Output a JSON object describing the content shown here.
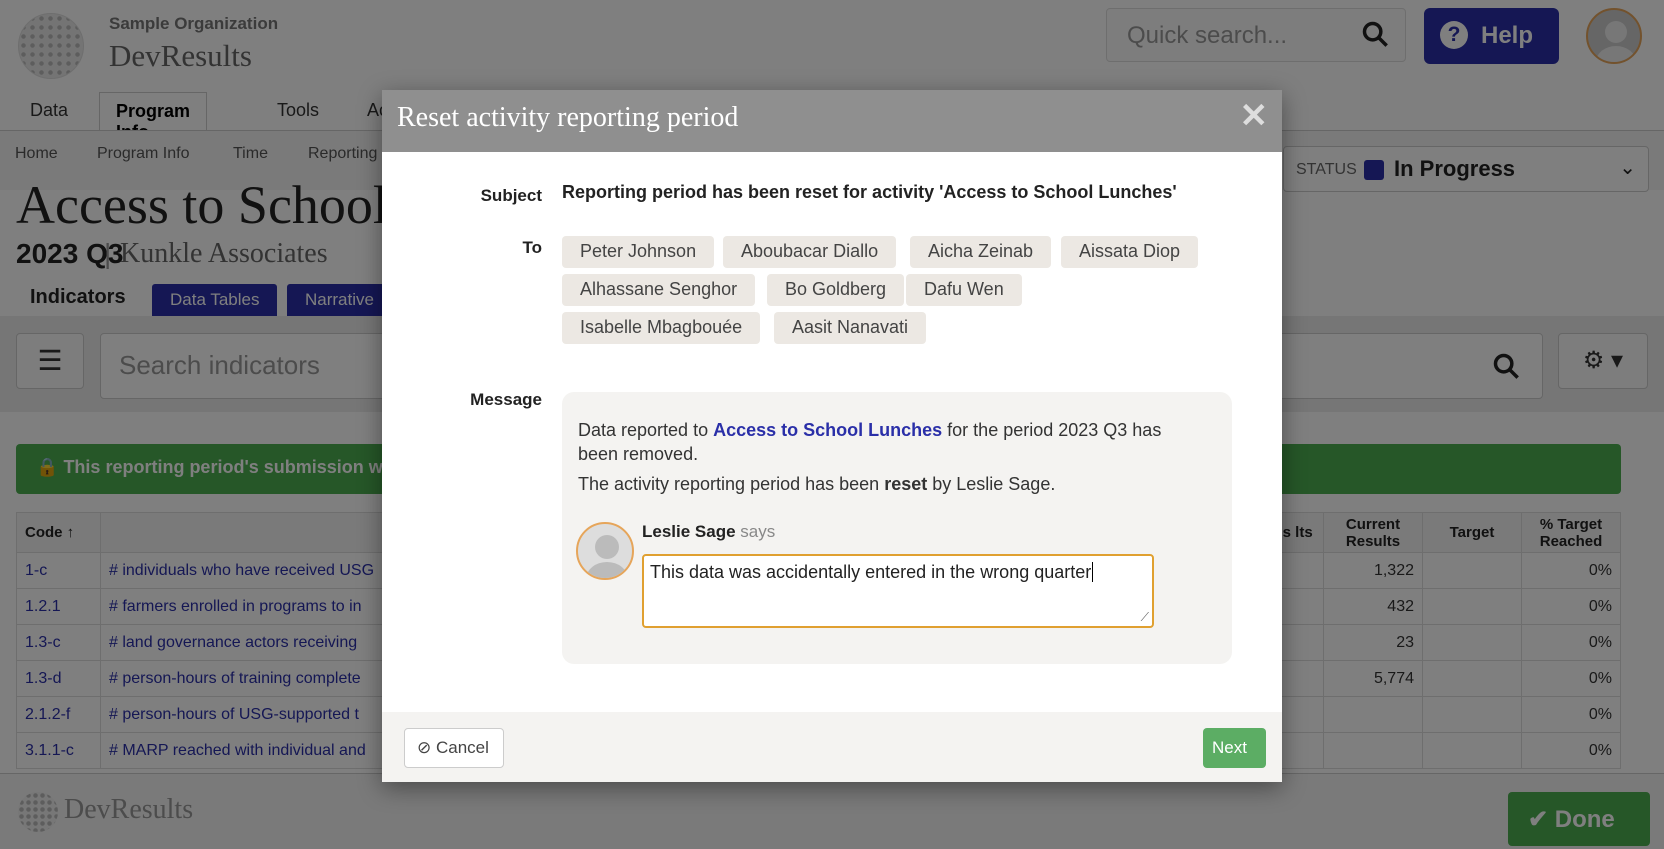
{
  "header": {
    "org_name": "Sample Organization",
    "brand": "DevResults",
    "quick_search_placeholder": "Quick search...",
    "help_label": "Help"
  },
  "nav": {
    "tabs": [
      "Data",
      "Program Info",
      "Tools",
      "Ac"
    ]
  },
  "breadcrumb": [
    "Home",
    "Program Info",
    "Time",
    "Reporting"
  ],
  "status": {
    "label": "STATUS",
    "value": "In Progress"
  },
  "page": {
    "title": "Access to School",
    "period": "2023 Q3",
    "separator": "|",
    "partner": "Kunkle Associates",
    "subtabs": [
      "Indicators",
      "Data Tables",
      "Narrative"
    ]
  },
  "toolbar": {
    "search_placeholder": "Search indicators"
  },
  "banner": {
    "text": "This reporting period's submission w"
  },
  "table": {
    "headers": {
      "code": "Code",
      "prev": "ous lts",
      "current": "Current Results",
      "target": "Target",
      "pct": "% Target Reached"
    },
    "rows": [
      {
        "code": "1-c",
        "name": "# individuals who have received USG",
        "current": "1,322",
        "target": "",
        "pct": "0%"
      },
      {
        "code": "1.2.1",
        "name": "# farmers enrolled in programs to in",
        "current": "432",
        "target": "",
        "pct": "0%"
      },
      {
        "code": "1.3-c",
        "name": "# land governance actors receiving",
        "current": "23",
        "target": "",
        "pct": "0%"
      },
      {
        "code": "1.3-d",
        "name": "# person-hours of training complete",
        "current": "5,774",
        "target": "",
        "pct": "0%"
      },
      {
        "code": "2.1.2-f",
        "name": "# person-hours of USG-supported t",
        "current": "",
        "target": "",
        "pct": "0%"
      },
      {
        "code": "3.1.1-c",
        "name": "# MARP reached with individual and",
        "current": "",
        "target": "",
        "pct": "0%"
      }
    ]
  },
  "footer": {
    "brand": "DevResults",
    "done_label": "Done"
  },
  "modal": {
    "title": "Reset activity reporting period",
    "subject_label": "Subject",
    "subject": "Reporting period has been reset for activity 'Access to School Lunches'",
    "to_label": "To",
    "recipients": [
      "Peter Johnson",
      "Aboubacar Diallo",
      "Aicha Zeinab",
      "Aissata Diop",
      "Alhassane Senghor",
      "Bo Goldberg",
      "Dafu Wen",
      "Isabelle Mbagbouée",
      "Aasit Nanavati"
    ],
    "message_label": "Message",
    "message": {
      "part1": "Data reported to",
      "activity_link": "Access to School Lunches",
      "part2": "for the period 2023 Q3 has been removed.",
      "line2_pre": "The activity reporting period has been",
      "line2_bold": "reset",
      "line2_post": "by Leslie Sage."
    },
    "comment": {
      "author": "Leslie Sage",
      "says": "says",
      "value": "This data was accidentally entered in the wrong quarter"
    },
    "cancel_label": "Cancel",
    "next_label": "Next"
  }
}
